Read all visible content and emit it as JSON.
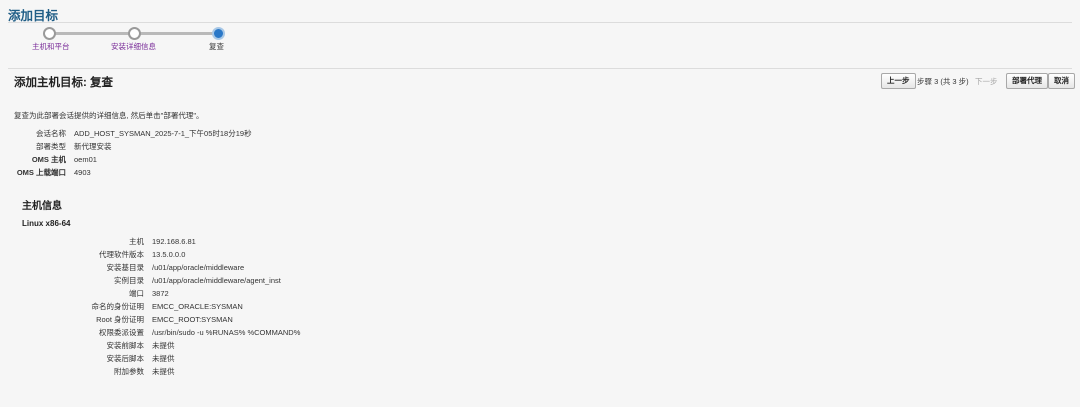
{
  "page": {
    "title": "添加目标"
  },
  "train": {
    "steps": [
      {
        "label": "主机和平台",
        "state": "visited"
      },
      {
        "label": "安装详细信息",
        "state": "visited"
      },
      {
        "label": "复查",
        "state": "current"
      }
    ]
  },
  "review": {
    "heading": "添加主机目标: 复查",
    "instruction": "复查为此部署会话提供的详细信息, 然后单击\"部署代理\"。"
  },
  "toolbar": {
    "back_label": "上一步",
    "step_indicator": "步骤 3 (共 3 步)",
    "next_label": "下一步",
    "deploy_label": "部署代理",
    "cancel_label": "取消"
  },
  "session": [
    {
      "label": "会话名称",
      "value": "ADD_HOST_SYSMAN_2025-7-1_下午05时18分19秒"
    },
    {
      "label": "部署类型",
      "value": "新代理安装"
    },
    {
      "label": "OMS 主机",
      "value": "oem01"
    },
    {
      "label": "OMS 上载端口",
      "value": "4903"
    }
  ],
  "host_info": {
    "heading": "主机信息",
    "platform": "Linux x86-64",
    "rows": [
      {
        "label": "主机",
        "value": "192.168.6.81"
      },
      {
        "label": "代理软件版本",
        "value": "13.5.0.0.0"
      },
      {
        "label": "安装基目录",
        "value": "/u01/app/oracle/middleware"
      },
      {
        "label": "实例目录",
        "value": "/u01/app/oracle/middleware/agent_inst"
      },
      {
        "label": "端口",
        "value": "3872"
      },
      {
        "label": "命名的身份证明",
        "value": "EMCC_ORACLE:SYSMAN"
      },
      {
        "label": "Root 身份证明",
        "value": "EMCC_ROOT:SYSMAN"
      },
      {
        "label": "权限委派设置",
        "value": "/usr/bin/sudo -u %RUNAS% %COMMAND%"
      },
      {
        "label": "安装前脚本",
        "value": "未提供"
      },
      {
        "label": "安装后脚本",
        "value": "未提供"
      },
      {
        "label": "附加参数",
        "value": "未提供"
      }
    ]
  }
}
